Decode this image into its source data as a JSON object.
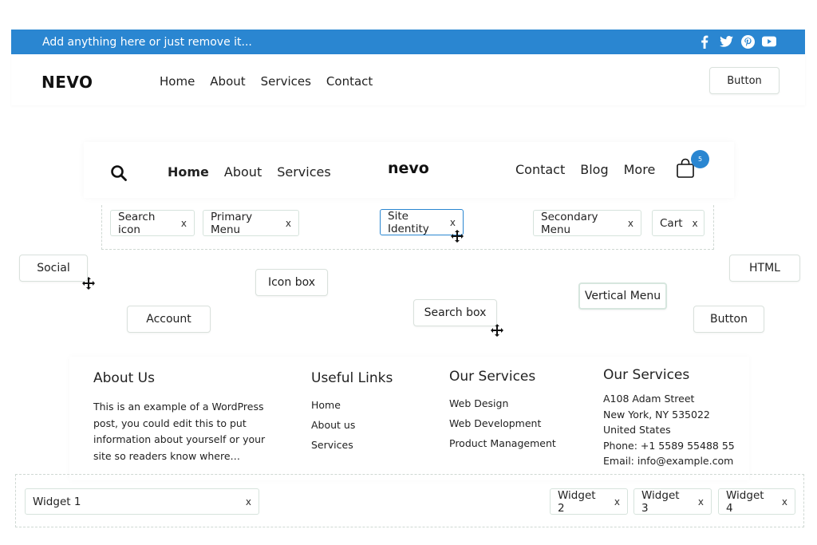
{
  "topbar": {
    "text": "Add anything here or just remove it...",
    "bg_color": "#2a86d1",
    "social": [
      "facebook-icon",
      "twitter-icon",
      "pinterest-icon",
      "youtube-icon"
    ]
  },
  "header1": {
    "logo": "NEVO",
    "nav": [
      "Home",
      "About",
      "Services",
      "Contact"
    ],
    "button": "Button"
  },
  "header2": {
    "nav_left": [
      "Home",
      "About",
      "Services"
    ],
    "logo": "nevo",
    "nav_right": [
      "Contact",
      "Blog",
      "More"
    ],
    "cart_count": "5"
  },
  "header_components": {
    "search_icon": "Search icon",
    "primary_menu": "Primary Menu",
    "site_identity": "Site Identity",
    "secondary_menu": "Secondary Menu",
    "cart": "Cart",
    "remove": "x"
  },
  "available_components": {
    "social": "Social",
    "icon_box": "Icon box",
    "account": "Account",
    "search_box": "Search box",
    "vertical_menu": "Vertical Menu",
    "html": "HTML",
    "button": "Button"
  },
  "footer": {
    "about": {
      "title": "About Us",
      "text": "This is an example of a WordPress post, you could edit this to put information about yourself or your site so readers know where…"
    },
    "useful_links": {
      "title": "Useful Links",
      "links": [
        "Home",
        "About us",
        "Services"
      ]
    },
    "services": {
      "title": "Our Services",
      "links": [
        "Web Design",
        "Web Development",
        "Product Management"
      ]
    },
    "contact": {
      "title": "Our Services",
      "lines": [
        "A108 Adam Street",
        "New York, NY 535022",
        "United States",
        "Phone: +1 5589 55488 55",
        "Email: info@example.com"
      ]
    }
  },
  "footer_widgets": {
    "widget1": "Widget 1",
    "widget2": "Widget 2",
    "widget3": "Widget 3",
    "widget4": "Widget 4",
    "remove": "x"
  }
}
